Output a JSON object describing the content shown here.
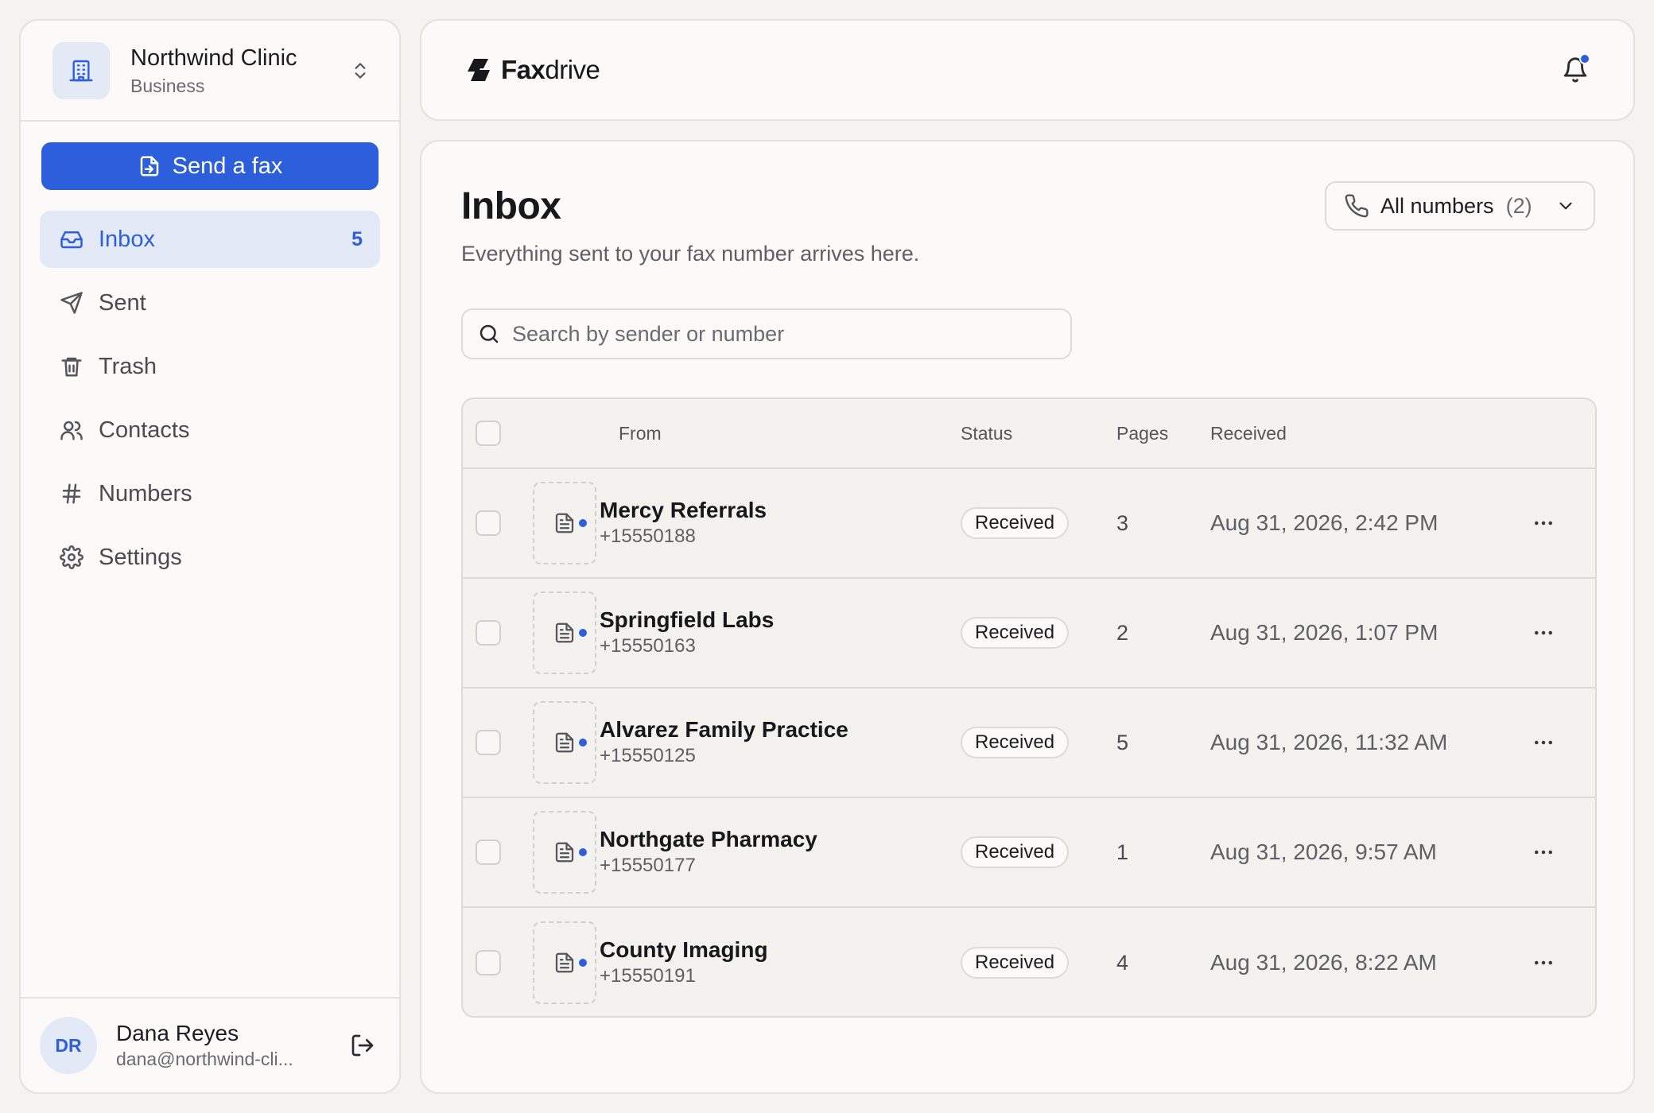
{
  "org": {
    "name": "Northwind Clinic",
    "plan": "Business"
  },
  "sidebar": {
    "send_label": "Send a fax",
    "items": [
      {
        "label": "Inbox",
        "icon": "inbox-icon",
        "count": "5",
        "active": true
      },
      {
        "label": "Sent",
        "icon": "send-icon"
      },
      {
        "label": "Trash",
        "icon": "trash-icon"
      },
      {
        "label": "Contacts",
        "icon": "contacts-icon"
      },
      {
        "label": "Numbers",
        "icon": "hash-icon"
      },
      {
        "label": "Settings",
        "icon": "gear-icon"
      }
    ]
  },
  "user": {
    "initials": "DR",
    "name": "Dana Reyes",
    "email": "dana@northwind-cli..."
  },
  "header": {
    "brand_bold": "Fax",
    "brand_rest": "drive",
    "has_notification": true,
    "accent": "#2d5fdc"
  },
  "main": {
    "title": "Inbox",
    "subtitle": "Everything sent to your fax number arrives here.",
    "numbers_filter": {
      "label": "All numbers",
      "count": "(2)"
    },
    "search": {
      "placeholder": "Search by sender or number",
      "value": ""
    }
  },
  "table": {
    "headers": {
      "from": "From",
      "status": "Status",
      "pages": "Pages",
      "received": "Received"
    },
    "rows": [
      {
        "sender": "Mercy Referrals",
        "number": "+15550188",
        "status": "Received",
        "pages": "3",
        "received": "Aug 31, 2026, 2:42 PM",
        "unread": true
      },
      {
        "sender": "Springfield Labs",
        "number": "+15550163",
        "status": "Received",
        "pages": "2",
        "received": "Aug 31, 2026, 1:07 PM",
        "unread": true
      },
      {
        "sender": "Alvarez Family Practice",
        "number": "+15550125",
        "status": "Received",
        "pages": "5",
        "received": "Aug 31, 2026, 11:32 AM",
        "unread": true
      },
      {
        "sender": "Northgate Pharmacy",
        "number": "+15550177",
        "status": "Received",
        "pages": "1",
        "received": "Aug 31, 2026, 9:57 AM",
        "unread": true
      },
      {
        "sender": "County Imaging",
        "number": "+15550191",
        "status": "Received",
        "pages": "4",
        "received": "Aug 31, 2026, 8:22 AM",
        "unread": true
      }
    ]
  }
}
